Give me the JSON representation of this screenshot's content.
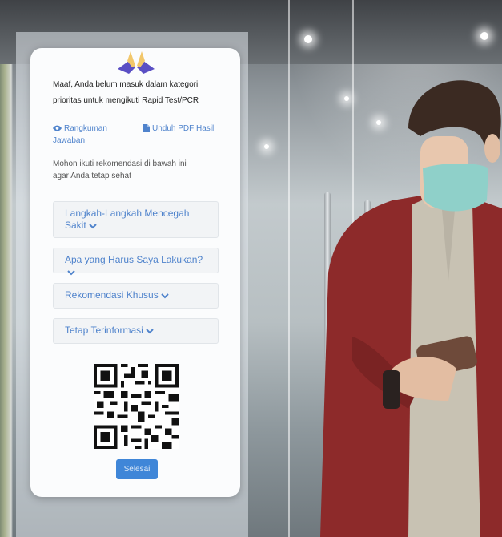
{
  "message": {
    "line1": "Maaf, Anda belum masuk dalam kategori",
    "line2": "prioritas untuk mengikuti Rapid Test/PCR"
  },
  "links": {
    "summary": {
      "line1": "Rangkuman",
      "line2": "Jawaban",
      "icon": "eye-icon"
    },
    "pdf": {
      "line1": "Unduh PDF Hasil",
      "icon": "file-icon"
    }
  },
  "advice": {
    "line1": "Mohon ikuti rekomendasi di bawah ini",
    "line2": "agar Anda tetap sehat"
  },
  "accordion": [
    {
      "line1": "Langkah-Langkah Mencegah",
      "line2": "Sakit"
    },
    {
      "line1": "Apa yang Harus Saya Lakukan?"
    },
    {
      "line1": "Rekomendasi Khusus"
    },
    {
      "line1": "Tetap Terinformasi"
    }
  ],
  "button": {
    "label": "Selesai"
  },
  "colors": {
    "accent": "#4f83cc",
    "button": "#3f86d8",
    "card": "#fbfcfd"
  }
}
